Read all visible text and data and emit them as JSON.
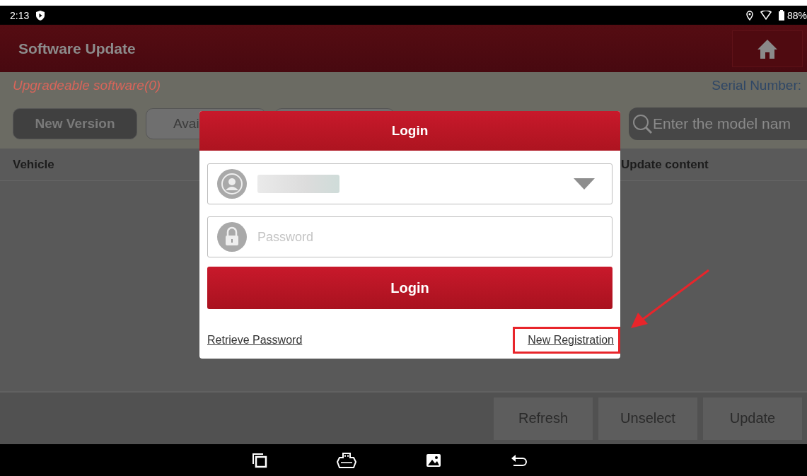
{
  "status_bar": {
    "time": "2:13",
    "battery": "88%"
  },
  "header": {
    "title": "Software Update"
  },
  "subheader": {
    "count_label": "Upgradeable software(0)",
    "serial_label": "Serial Number:"
  },
  "tabs": [
    {
      "label": "New Version",
      "selected": true
    },
    {
      "label": "Avai",
      "selected": false
    },
    {
      "selected": false
    }
  ],
  "search": {
    "placeholder": "Enter the model nam"
  },
  "table": {
    "columns": [
      "Vehicle",
      "Update content"
    ]
  },
  "footer_buttons": [
    "Refresh",
    "Unselect",
    "Update"
  ],
  "login_dialog": {
    "title": "Login",
    "password_placeholder": "Password",
    "login_button": "Login",
    "retrieve_link": "Retrieve Password",
    "register_link": "New Registration",
    "register_highlighted": true
  }
}
